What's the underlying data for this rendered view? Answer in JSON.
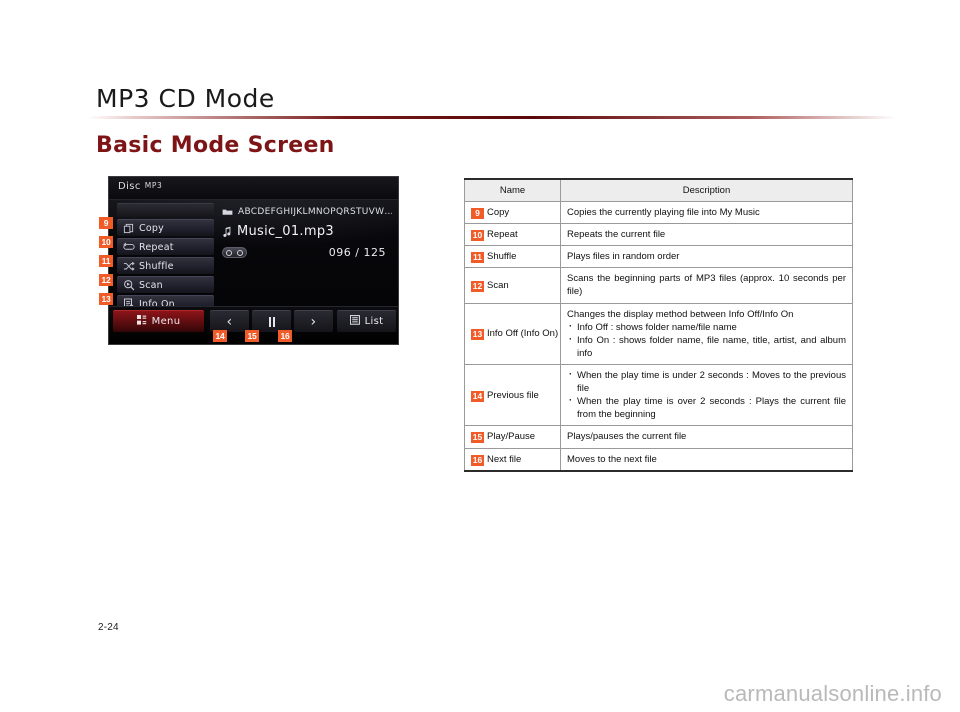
{
  "page": {
    "title": "MP3 CD Mode",
    "section_title": "Basic Mode Screen",
    "page_number": "2-24",
    "watermark": "carmanualsonline.info",
    "accent_red": "#7e1416",
    "callout_orange": "#f15b28"
  },
  "device_screen": {
    "status_bar": {
      "source": "Disc",
      "format": "MP3"
    },
    "menu_items": [
      {
        "label": "Copy",
        "icon": "copy-icon",
        "callout": "9"
      },
      {
        "label": "Repeat",
        "icon": "repeat-icon",
        "callout": "10"
      },
      {
        "label": "Shuffle",
        "icon": "shuffle-icon",
        "callout": "11"
      },
      {
        "label": "Scan",
        "icon": "scan-icon",
        "callout": "12"
      },
      {
        "label": "Info On",
        "icon": "info-icon",
        "callout": "13"
      }
    ],
    "now_playing": {
      "folder_icon": "folder-icon",
      "folder_name": "ABCDEFGHIJKLMNOPQRSTUVW…",
      "file_icon": "music-note-icon",
      "file_name": "Music_01.mp3",
      "mode_indicator_icon": "repeat-pill-icon",
      "track_position": "096 / 125"
    },
    "bottom_bar": {
      "menu_label": "Menu",
      "menu_icon": "grid-icon",
      "previous_icon": "chevron-left-icon",
      "play_pause_icon": "pause-icon",
      "next_icon": "chevron-right-icon",
      "list_label": "List",
      "list_icon": "list-icon",
      "callouts": {
        "previous": "14",
        "play_pause": "15",
        "next": "16"
      }
    }
  },
  "table": {
    "headers": {
      "name": "Name",
      "description": "Description"
    },
    "rows": [
      {
        "num": "9",
        "name": "Copy",
        "desc_type": "plain",
        "desc": "Copies the currently playing file into My Music"
      },
      {
        "num": "10",
        "name": "Repeat",
        "desc_type": "plain",
        "desc": "Repeats the current file"
      },
      {
        "num": "11",
        "name": "Shuffle",
        "desc_type": "plain",
        "desc": "Plays files in random order"
      },
      {
        "num": "12",
        "name": "Scan",
        "desc_type": "plain",
        "desc": "Scans the beginning parts of MP3 files (approx. 10 seconds per file)"
      },
      {
        "num": "13",
        "name": "Info Off (Info On)",
        "desc_type": "lead_list",
        "desc_lead": "Changes the display method between Info Off/Info On",
        "desc_items": [
          "Info Off : shows folder name/file name",
          "Info On : shows folder name, file name, title, artist, and album info"
        ]
      },
      {
        "num": "14",
        "name": "Previous file",
        "desc_type": "list",
        "desc_items": [
          "When the play time is under 2 seconds : Moves to the previous file",
          "When the play time is over 2 seconds : Plays the current file from the beginning"
        ]
      },
      {
        "num": "15",
        "name": "Play/Pause",
        "desc_type": "plain",
        "desc": "Plays/pauses the current file"
      },
      {
        "num": "16",
        "name": "Next file",
        "desc_type": "plain",
        "desc": "Moves to the next file"
      }
    ]
  }
}
